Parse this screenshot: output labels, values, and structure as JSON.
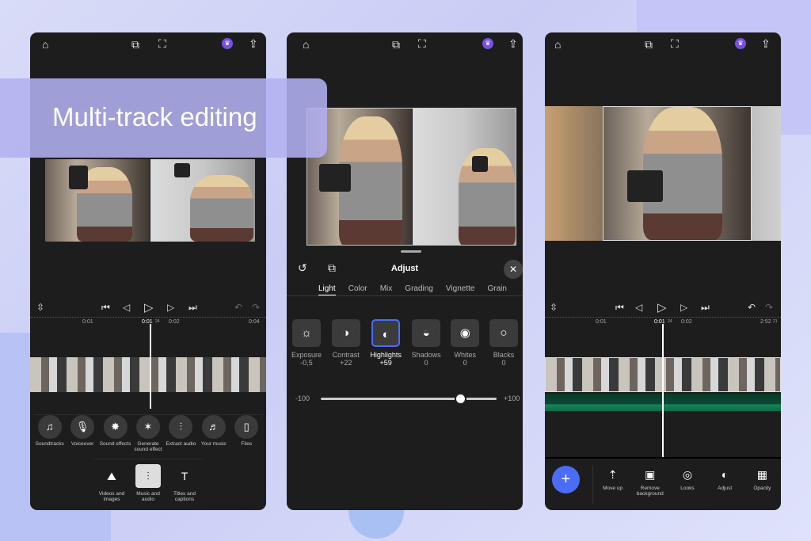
{
  "banner": {
    "title": "Multi-track editing"
  },
  "phone1": {
    "ruler": [
      "0:01",
      "0:01",
      "24",
      "0:02",
      "0:04"
    ],
    "audio_tools": [
      {
        "icon": "♫",
        "label": "Soundtracks"
      },
      {
        "icon": "🎙",
        "label": "Voiceover"
      },
      {
        "icon": "✸",
        "label": "Sound effects"
      },
      {
        "icon": "✶",
        "label": "Generate sound effect"
      },
      {
        "icon": "⫶",
        "label": "Extract audio"
      },
      {
        "icon": "♬",
        "label": "Your music"
      },
      {
        "icon": "▯",
        "label": "Files"
      }
    ],
    "nav": [
      {
        "icon": "⛰",
        "label": "Videos and images"
      },
      {
        "icon": "⫶",
        "label": "Music and audio"
      },
      {
        "icon": "T",
        "label": "Titles and captions"
      }
    ]
  },
  "phone2": {
    "title": "Adjust",
    "tabs": [
      "Light",
      "Color",
      "Mix",
      "Grading",
      "Vignette",
      "Grain"
    ],
    "adjustments": [
      {
        "icon": "☼",
        "label": "Exposure",
        "value": "-0,5"
      },
      {
        "icon": "◑",
        "label": "Contrast",
        "value": "+22"
      },
      {
        "icon": "◐",
        "label": "Highlights",
        "value": "+59"
      },
      {
        "icon": "◒",
        "label": "Shadows",
        "value": "0"
      },
      {
        "icon": "◉",
        "label": "Whites",
        "value": "0"
      },
      {
        "icon": "○",
        "label": "Blacks",
        "value": "0"
      }
    ],
    "slider": {
      "min": "-100",
      "max": "+100",
      "value": 59
    }
  },
  "phone3": {
    "ruler": [
      "0:01",
      "0:01",
      "24",
      "0:02",
      "2:52",
      "21"
    ],
    "tools": [
      {
        "icon": "⇡",
        "label": "Move up"
      },
      {
        "icon": "▣",
        "label": "Remove background"
      },
      {
        "icon": "◎",
        "label": "Looks"
      },
      {
        "icon": "◐",
        "label": "Adjust"
      },
      {
        "icon": "▦",
        "label": "Opacity"
      }
    ],
    "add_label": "+"
  },
  "colors": {
    "accent": "#4a6cf7",
    "audio": "#0f5a3a",
    "crown": "#7a4fe0"
  }
}
